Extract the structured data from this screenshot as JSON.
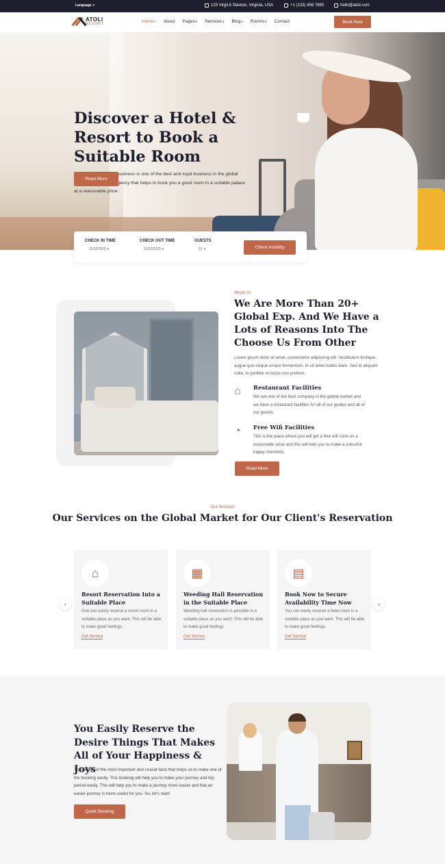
{
  "topbar": {
    "language": "Language",
    "address": "123 Virgil A Stanton, Virginia, USA",
    "phone": "+1 (123) 456 7890",
    "email": "hello@atoli.com"
  },
  "nav": {
    "logo_name": "ATOLI",
    "logo_sub": "RESORT",
    "items": [
      "Home",
      "About",
      "Pages",
      "Services",
      "Blog",
      "Rooms",
      "Contact"
    ],
    "book_now": "Book Now"
  },
  "hero": {
    "title": "Discover a Hotel & Resort to Book a Suitable Room",
    "text": "The hotel and resort business is one of the best and loyal business in the global market. We are the agency that helps to book you a good room in a suitable palace at a reasonable price.",
    "button": "Read More"
  },
  "booking": {
    "checkin_label": "CHECK IN TIME",
    "checkin_value": "11/02/2020",
    "checkout_label": "CHECK OUT TIME",
    "checkout_value": "11/02/2020",
    "guests_label": "GUESTS",
    "guests_value": "01",
    "button": "Check Arability"
  },
  "about": {
    "tag": "About Us",
    "title": "We Are More Than 20+ Global Exp. And We Have a Lots of Reasons Into The Choose Us From Other",
    "text": "Lorem ipsum dolor sit amet, consectetur adipiscing elit. Vestibulum tristique augue quis neque ornare fermentum. In sit amet mattis diam. Sed id aliquam nulla. In porttitor et turpis non pretium.",
    "features": [
      {
        "title": "Restaurant Facilities",
        "text": "We are one of the best company in the global market and we have a restaurant facilities for all of our guides and all of our guests."
      },
      {
        "title": "Free Wifi Facilities",
        "text": "This is the place where you will get a free wifi zone on a reasonable price and this will help you to make a colourful happy moments."
      }
    ],
    "button": "Read More"
  },
  "services": {
    "tag": "Our Services",
    "title": "Our Services on the Global Market for Our Client's Reservation",
    "cards": [
      {
        "title": "Resort Reservation Into a Suitable Place",
        "text": "One can easily reserve a resort room in a suitable place as you want. This will be able to make good feelings.",
        "link": "Get Service"
      },
      {
        "title": "Weeding Hall Reservation in the Suitable Place",
        "text": "Weeding hall reservation is possible in a suitable place as you want. This will be able to make good feelings.",
        "link": "Get Service"
      },
      {
        "title": "Book Now to Secure Availability Time Now",
        "text": "You can easily reserve a hotel room in a suitable place as you want. This will be able to make good feelings.",
        "link": "Get Service"
      }
    ]
  },
  "reserve": {
    "title": "You Easily Reserve the Desire Things That Makes All of Your Happiness & Joys",
    "text": "This is one of the most important and crucial facts that helps us to make one of the booking easily. This booking will help you to make your journey and trip period easily. This will help you to make a journey more easier and that an easier journey is more useful for you. So, let's start!",
    "button": "Quick Booking"
  }
}
